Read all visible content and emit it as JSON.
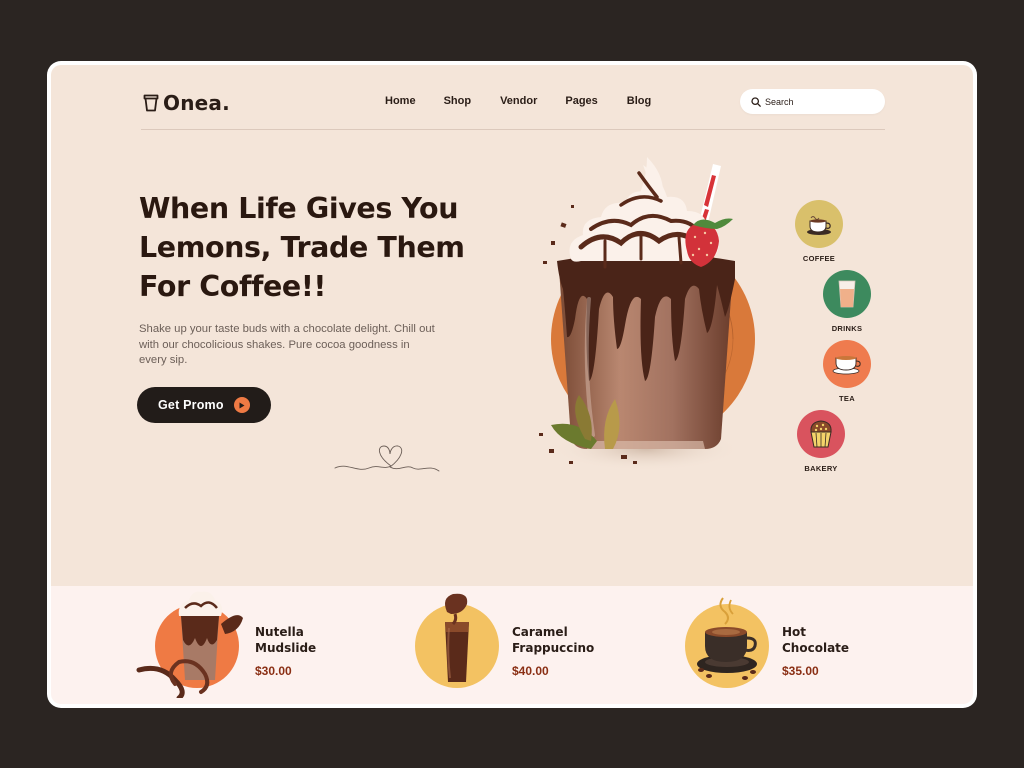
{
  "brand": {
    "name": "Onea.",
    "icon": "cup-icon"
  },
  "nav": {
    "items": [
      "Home",
      "Shop",
      "Vendor",
      "Pages",
      "Blog"
    ]
  },
  "search": {
    "placeholder": "Search",
    "icon": "search-icon"
  },
  "hero": {
    "headline": [
      "When Life Gives You",
      "Lemons, Trade Them",
      "For Coffee!!"
    ],
    "description": "Shake up your taste buds with a chocolate delight. Chill out with our chocolicious shakes. Pure cocoa goodness in every sip.",
    "cta_label": "Get Promo",
    "cta_icon": "play-icon"
  },
  "categories": [
    {
      "label": "COFFEE",
      "color": "#d9c06b",
      "icon": "coffee-cup-icon"
    },
    {
      "label": "DRINKS",
      "color": "#3d8a5e",
      "icon": "drink-glass-icon"
    },
    {
      "label": "TEA",
      "color": "#ef7b4e",
      "icon": "tea-cup-icon"
    },
    {
      "label": "BAKERY",
      "color": "#d9535e",
      "icon": "muffin-icon"
    }
  ],
  "products": [
    {
      "name": [
        "Nutella",
        "Mudslide"
      ],
      "price": "$30.00",
      "color": "#ef7a44",
      "icon": "milkshake-icon"
    },
    {
      "name": [
        "Caramel",
        "Frappuccino"
      ],
      "price": "$40.00",
      "color": "#f3c262",
      "icon": "frappuccino-icon"
    },
    {
      "name": [
        "Hot",
        "Chocolate"
      ],
      "price": "$35.00",
      "color": "#f3c262",
      "icon": "hot-chocolate-icon"
    }
  ],
  "colors": {
    "accent": "#ef7a44",
    "dark": "#221c19",
    "hero_bg": "#f4e5d9",
    "price": "#8a2f14"
  }
}
